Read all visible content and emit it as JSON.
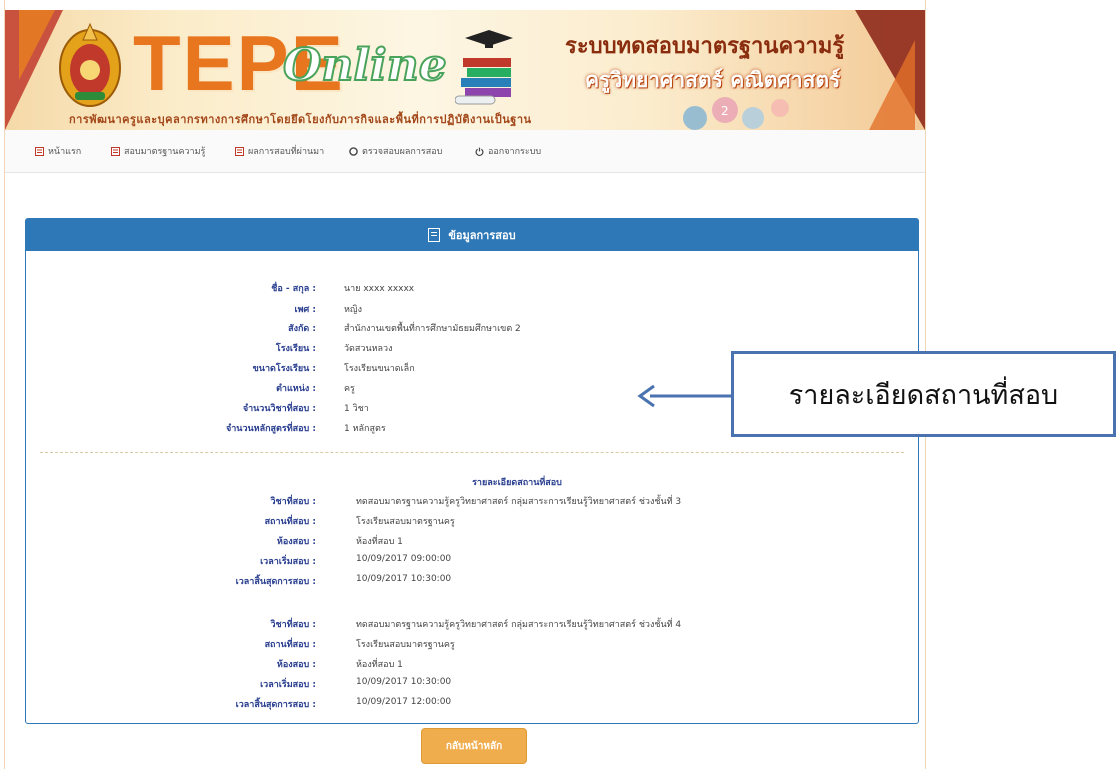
{
  "header": {
    "logo_tepe": "TEPE",
    "logo_online": "Online",
    "title_line1": "ระบบทดสอบมาตรฐานความรู้",
    "title_line2": "ครูวิทยาศาสตร์ คณิตศาสตร์",
    "subtitle": "การพัฒนาครูและบุคลากรทางการศึกษาโดยยึดโยงกับภารกิจและพื้นที่การปฏิบัติงานเป็นฐาน"
  },
  "nav": {
    "items": [
      {
        "label": "หน้าแรก",
        "icon": "doc-icon"
      },
      {
        "label": "สอบมาตรฐานความรู้",
        "icon": "doc-icon"
      },
      {
        "label": "ผลการสอบที่ผ่านมา",
        "icon": "doc-icon"
      },
      {
        "label": "ตรวจสอบผลการสอบ",
        "icon": "circle-icon"
      },
      {
        "label": "ออกจากระบบ",
        "icon": "power-icon"
      }
    ]
  },
  "panel": {
    "title": "ข้อมูลการสอบ",
    "info": [
      {
        "label": "ชื่อ - สกุล :",
        "value": "นาย xxxx xxxxx"
      },
      {
        "label": "เพศ :",
        "value": "หญิง"
      },
      {
        "label": "สังกัด :",
        "value": "สำนักงานเขตพื้นที่การศึกษามัธยมศึกษาเขต 2"
      },
      {
        "label": "โรงเรียน :",
        "value": "วัดสวนหลวง"
      },
      {
        "label": "ขนาดโรงเรียน :",
        "value": "โรงเรียนขนาดเล็ก"
      },
      {
        "label": "ตำแหน่ง :",
        "value": "ครู"
      },
      {
        "label": "จำนวนวิชาที่สอบ :",
        "value": "1 วิชา"
      },
      {
        "label": "จำนวนหลักสูตรที่สอบ :",
        "value": "1 หลักสูตร"
      }
    ],
    "exam_section_title": "รายละเอียดสถานที่สอบ",
    "exams": [
      {
        "rows": [
          {
            "label": "วิชาที่สอบ :",
            "value": "ทดสอบมาตรฐานความรู้ครูวิทยาศาสตร์ กลุ่มสาระการเรียนรู้วิทยาศาสตร์ ช่วงชั้นที่ 3"
          },
          {
            "label": "สถานที่สอบ :",
            "value": "โรงเรียนสอบมาตรฐานครู"
          },
          {
            "label": "ห้องสอบ :",
            "value": "ห้องที่สอบ 1"
          },
          {
            "label": "เวลาเริ่มสอบ :",
            "value": "10/09/2017 09:00:00"
          },
          {
            "label": "เวลาสิ้นสุดการสอบ :",
            "value": "10/09/2017 10:30:00"
          }
        ]
      },
      {
        "rows": [
          {
            "label": "วิชาที่สอบ :",
            "value": "ทดสอบมาตรฐานความรู้ครูวิทยาศาสตร์ กลุ่มสาระการเรียนรู้วิทยาศาสตร์ ช่วงชั้นที่ 4"
          },
          {
            "label": "สถานที่สอบ :",
            "value": "โรงเรียนสอบมาตรฐานครู"
          },
          {
            "label": "ห้องสอบ :",
            "value": "ห้องที่สอบ 1"
          },
          {
            "label": "เวลาเริ่มสอบ :",
            "value": "10/09/2017 10:30:00"
          },
          {
            "label": "เวลาสิ้นสุดการสอบ :",
            "value": "10/09/2017 12:00:00"
          }
        ]
      }
    ]
  },
  "home_button": "กลับหน้าหลัก",
  "callout": {
    "text": "รายละเอียดสถานที่สอบ"
  },
  "colors": {
    "panel_blue": "#2f78b7",
    "button_orange": "#f0ad4e",
    "logo_orange": "#e8761f",
    "callout_border": "#4a72b0"
  }
}
